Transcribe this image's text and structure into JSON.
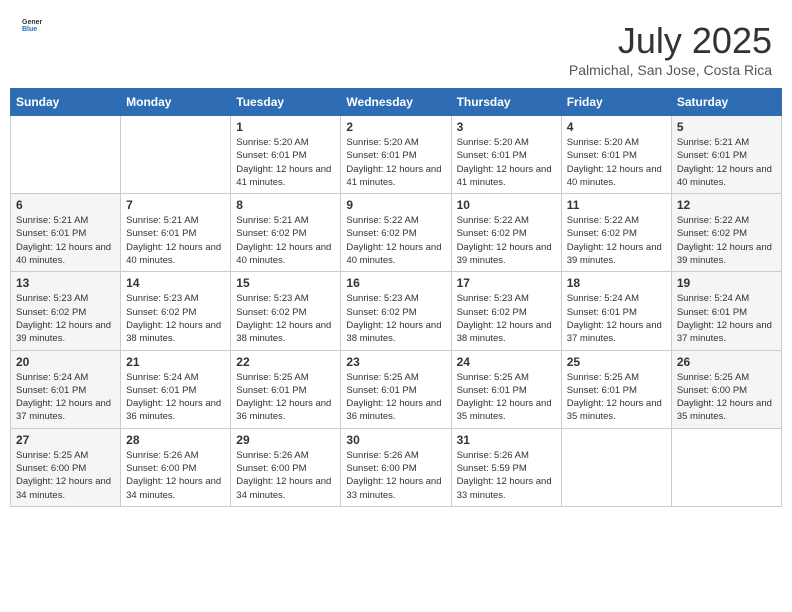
{
  "header": {
    "logo_general": "General",
    "logo_blue": "Blue",
    "month_year": "July 2025",
    "location": "Palmichal, San Jose, Costa Rica"
  },
  "days_of_week": [
    "Sunday",
    "Monday",
    "Tuesday",
    "Wednesday",
    "Thursday",
    "Friday",
    "Saturday"
  ],
  "weeks": [
    {
      "days": [
        {
          "num": "",
          "info": ""
        },
        {
          "num": "",
          "info": ""
        },
        {
          "num": "1",
          "info": "Sunrise: 5:20 AM\nSunset: 6:01 PM\nDaylight: 12 hours and 41 minutes."
        },
        {
          "num": "2",
          "info": "Sunrise: 5:20 AM\nSunset: 6:01 PM\nDaylight: 12 hours and 41 minutes."
        },
        {
          "num": "3",
          "info": "Sunrise: 5:20 AM\nSunset: 6:01 PM\nDaylight: 12 hours and 41 minutes."
        },
        {
          "num": "4",
          "info": "Sunrise: 5:20 AM\nSunset: 6:01 PM\nDaylight: 12 hours and 40 minutes."
        },
        {
          "num": "5",
          "info": "Sunrise: 5:21 AM\nSunset: 6:01 PM\nDaylight: 12 hours and 40 minutes."
        }
      ]
    },
    {
      "days": [
        {
          "num": "6",
          "info": "Sunrise: 5:21 AM\nSunset: 6:01 PM\nDaylight: 12 hours and 40 minutes."
        },
        {
          "num": "7",
          "info": "Sunrise: 5:21 AM\nSunset: 6:01 PM\nDaylight: 12 hours and 40 minutes."
        },
        {
          "num": "8",
          "info": "Sunrise: 5:21 AM\nSunset: 6:02 PM\nDaylight: 12 hours and 40 minutes."
        },
        {
          "num": "9",
          "info": "Sunrise: 5:22 AM\nSunset: 6:02 PM\nDaylight: 12 hours and 40 minutes."
        },
        {
          "num": "10",
          "info": "Sunrise: 5:22 AM\nSunset: 6:02 PM\nDaylight: 12 hours and 39 minutes."
        },
        {
          "num": "11",
          "info": "Sunrise: 5:22 AM\nSunset: 6:02 PM\nDaylight: 12 hours and 39 minutes."
        },
        {
          "num": "12",
          "info": "Sunrise: 5:22 AM\nSunset: 6:02 PM\nDaylight: 12 hours and 39 minutes."
        }
      ]
    },
    {
      "days": [
        {
          "num": "13",
          "info": "Sunrise: 5:23 AM\nSunset: 6:02 PM\nDaylight: 12 hours and 39 minutes."
        },
        {
          "num": "14",
          "info": "Sunrise: 5:23 AM\nSunset: 6:02 PM\nDaylight: 12 hours and 38 minutes."
        },
        {
          "num": "15",
          "info": "Sunrise: 5:23 AM\nSunset: 6:02 PM\nDaylight: 12 hours and 38 minutes."
        },
        {
          "num": "16",
          "info": "Sunrise: 5:23 AM\nSunset: 6:02 PM\nDaylight: 12 hours and 38 minutes."
        },
        {
          "num": "17",
          "info": "Sunrise: 5:23 AM\nSunset: 6:02 PM\nDaylight: 12 hours and 38 minutes."
        },
        {
          "num": "18",
          "info": "Sunrise: 5:24 AM\nSunset: 6:01 PM\nDaylight: 12 hours and 37 minutes."
        },
        {
          "num": "19",
          "info": "Sunrise: 5:24 AM\nSunset: 6:01 PM\nDaylight: 12 hours and 37 minutes."
        }
      ]
    },
    {
      "days": [
        {
          "num": "20",
          "info": "Sunrise: 5:24 AM\nSunset: 6:01 PM\nDaylight: 12 hours and 37 minutes."
        },
        {
          "num": "21",
          "info": "Sunrise: 5:24 AM\nSunset: 6:01 PM\nDaylight: 12 hours and 36 minutes."
        },
        {
          "num": "22",
          "info": "Sunrise: 5:25 AM\nSunset: 6:01 PM\nDaylight: 12 hours and 36 minutes."
        },
        {
          "num": "23",
          "info": "Sunrise: 5:25 AM\nSunset: 6:01 PM\nDaylight: 12 hours and 36 minutes."
        },
        {
          "num": "24",
          "info": "Sunrise: 5:25 AM\nSunset: 6:01 PM\nDaylight: 12 hours and 35 minutes."
        },
        {
          "num": "25",
          "info": "Sunrise: 5:25 AM\nSunset: 6:01 PM\nDaylight: 12 hours and 35 minutes."
        },
        {
          "num": "26",
          "info": "Sunrise: 5:25 AM\nSunset: 6:00 PM\nDaylight: 12 hours and 35 minutes."
        }
      ]
    },
    {
      "days": [
        {
          "num": "27",
          "info": "Sunrise: 5:25 AM\nSunset: 6:00 PM\nDaylight: 12 hours and 34 minutes."
        },
        {
          "num": "28",
          "info": "Sunrise: 5:26 AM\nSunset: 6:00 PM\nDaylight: 12 hours and 34 minutes."
        },
        {
          "num": "29",
          "info": "Sunrise: 5:26 AM\nSunset: 6:00 PM\nDaylight: 12 hours and 34 minutes."
        },
        {
          "num": "30",
          "info": "Sunrise: 5:26 AM\nSunset: 6:00 PM\nDaylight: 12 hours and 33 minutes."
        },
        {
          "num": "31",
          "info": "Sunrise: 5:26 AM\nSunset: 5:59 PM\nDaylight: 12 hours and 33 minutes."
        },
        {
          "num": "",
          "info": ""
        },
        {
          "num": "",
          "info": ""
        }
      ]
    }
  ]
}
